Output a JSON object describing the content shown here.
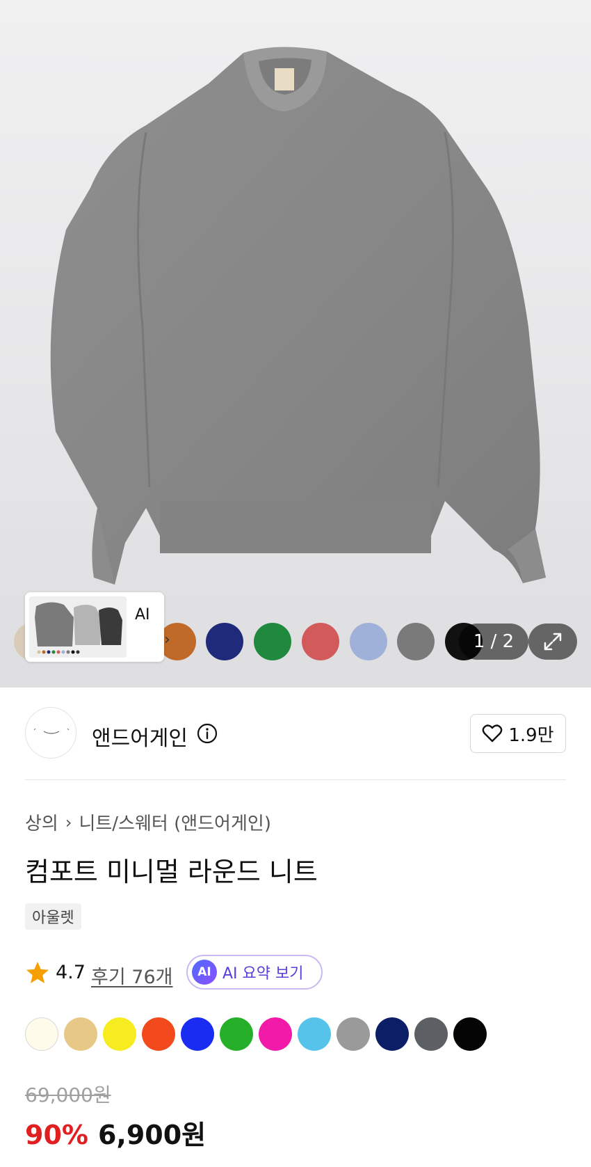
{
  "gallery": {
    "thumbnail_label": "AI",
    "page_counter": "1 / 2",
    "swatches": [
      "#d8cbb8",
      "#c06a2a",
      "#1f2a7a",
      "#1f8a3e",
      "#d25a5a",
      "#9fb1d8",
      "#7a7a7a",
      "#111111"
    ]
  },
  "brand": {
    "name": "앤드어게인",
    "like_count": "1.9만"
  },
  "product": {
    "breadcrumb": [
      "상의",
      "니트/스웨터 (앤드어게인)"
    ],
    "title": "컴포트 미니멀 라운드 니트",
    "tag": "아울렛",
    "rating": "4.7",
    "review_link": "후기 76개",
    "ai_badge": "AI",
    "ai_summary_label": "AI 요약 보기",
    "colors": [
      "#fffbea",
      "#e8c887",
      "#f7ec1f",
      "#f24a1c",
      "#1a2cf2",
      "#26b02a",
      "#f21aa8",
      "#55c3ea",
      "#9a9a9a",
      "#0c1e66",
      "#5c5f63",
      "#050505"
    ]
  },
  "price": {
    "original": "69,000원",
    "discount": "90%",
    "sale": "6,900원"
  },
  "theme": {
    "discount_color": "#e02020",
    "ai_color": "#5a3ed8"
  }
}
